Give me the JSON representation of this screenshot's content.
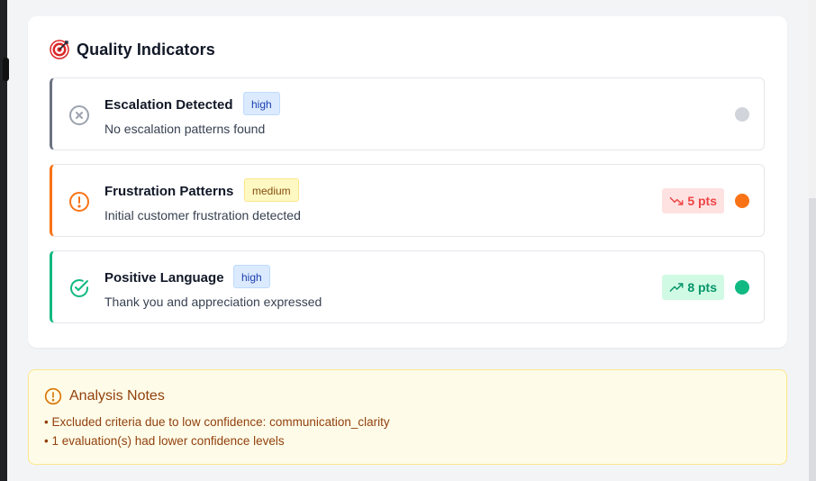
{
  "quality_indicators": {
    "title": "Quality Indicators",
    "icon": "target-icon",
    "items": [
      {
        "name": "Escalation Detected",
        "badge": "high",
        "description": "No escalation patterns found",
        "status": "neutral",
        "status_icon": "x-circle-icon",
        "accent_color": "#6b7280",
        "dot_color": "#d1d5db"
      },
      {
        "name": "Frustration Patterns",
        "badge": "medium",
        "description": "Initial customer frustration detected",
        "status": "warning",
        "status_icon": "alert-circle-icon",
        "accent_color": "#f97316",
        "dot_color": "#f97316",
        "points": "5 pts",
        "points_icon": "trending-down-icon"
      },
      {
        "name": "Positive Language",
        "badge": "high",
        "description": "Thank you and appreciation expressed",
        "status": "positive",
        "status_icon": "check-circle-icon",
        "accent_color": "#10b981",
        "dot_color": "#10b981",
        "points": "8 pts",
        "points_icon": "trending-up-icon"
      }
    ]
  },
  "analysis_notes": {
    "title": "Analysis Notes",
    "icon": "alert-circle-icon",
    "lines": [
      "• Excluded criteria due to low confidence: communication_clarity",
      "• 1 evaluation(s) had lower confidence levels"
    ],
    "accent_color": "#d97706"
  }
}
